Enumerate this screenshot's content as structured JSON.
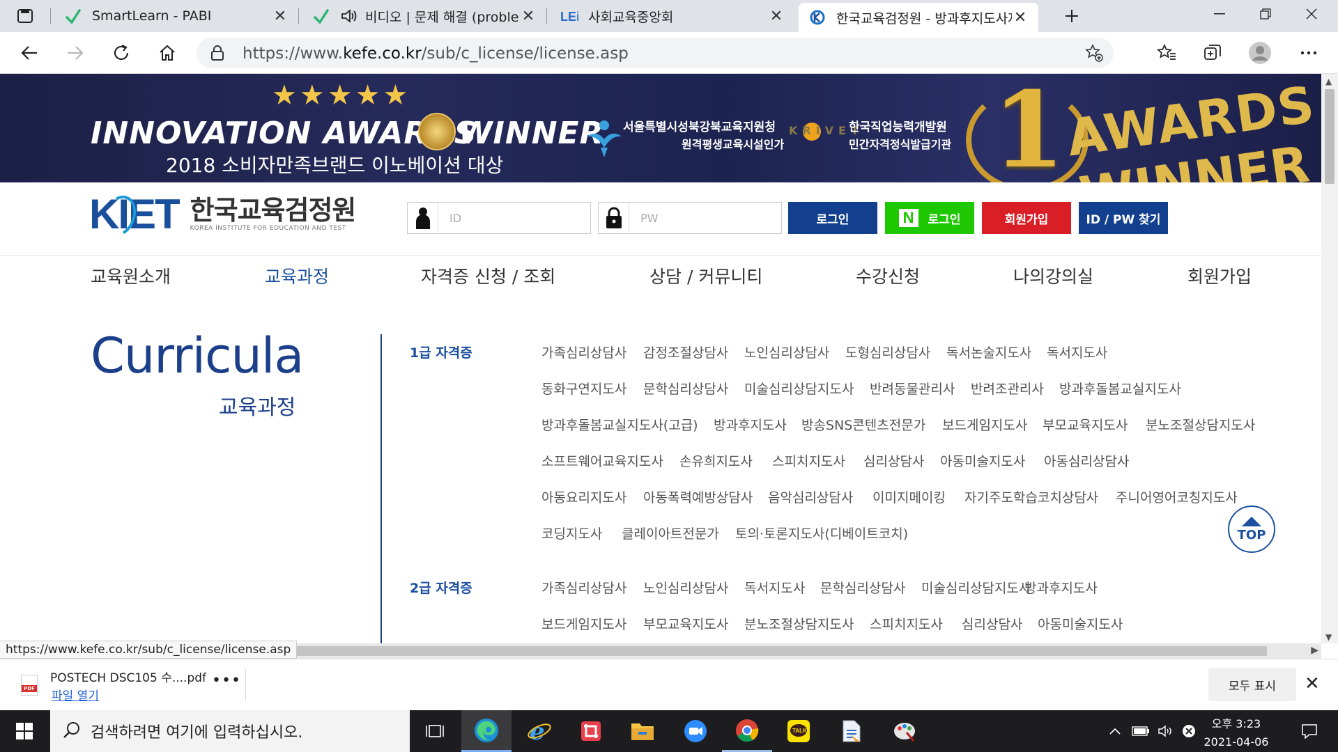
{
  "browser": {
    "tabs": [
      {
        "title": "SmartLearn - PABI",
        "active": false
      },
      {
        "title": "비디오 | 문제 해결 (problem",
        "active": false,
        "audio": true
      },
      {
        "title": "사회교육중앙회",
        "active": false
      },
      {
        "title": "한국교육검정원 - 방과후지도사자",
        "active": true
      }
    ],
    "url_prefix": "https://www.",
    "url_host": "kefe.co.kr",
    "url_path": "/sub/c_license/license.asp",
    "status_url": "https://www.kefe.co.kr/sub/c_license/license.asp"
  },
  "banner": {
    "stars": "★★★★★",
    "innovation": "INNOVATION AWARDS",
    "winner": "WINNER",
    "brand_award": "2018 소비자만족브랜드 이노베이션 대상",
    "seoul_line1": "서울특별시성북강북교육지원청",
    "seoul_line2": "원격평생교육시설인가",
    "krivet_logo": "KRIVET",
    "krivet_line1": "한국직업능력개발원",
    "krivet_line2": "민간자격정식발급기관",
    "big_number": "1",
    "awards_line1": "AWARDS",
    "awards_line2": "WINNER"
  },
  "site": {
    "logo_mark": "KIET",
    "logo_name": "한국교육검정원",
    "logo_en": "KOREA INSTITUTE FOR EDUCATION AND TEST",
    "id_placeholder": "ID",
    "pw_placeholder": "PW",
    "login_label": "로그인",
    "naver_mark": "N",
    "naver_login_label": "로그인",
    "join_label": "회원가입",
    "find_label": "ID / PW 찾기",
    "colors": {
      "login": "#12408f",
      "naver": "#1ec800",
      "join": "#d91e26",
      "find": "#12408f",
      "accent": "#1c3f8a"
    }
  },
  "gnb": [
    {
      "label": "교육원소개",
      "active": false
    },
    {
      "label": "교육과정",
      "active": true
    },
    {
      "label": "자격증 신청 / 조회",
      "active": false
    },
    {
      "label": "상담 / 커뮤니티",
      "active": false
    },
    {
      "label": "수강신청",
      "active": false
    },
    {
      "label": "나의강의실",
      "active": false
    },
    {
      "label": "회원가입",
      "active": false
    }
  ],
  "content": {
    "title": "Curricula",
    "subtitle": "교육과정",
    "grade1": {
      "label": "1급 자격증",
      "rows": [
        [
          "가족심리상담사",
          "감정조절상담사",
          "노인심리상담사",
          "도형심리상담사",
          "독서논술지도사",
          "독서지도사"
        ],
        [
          "동화구연지도사",
          "문학심리상담사",
          "미술심리상담지도사",
          "반려동물관리사",
          "반려조관리사",
          "방과후돌봄교실지도사"
        ],
        [
          "방과후돌봄교실지도사(고급)",
          "방과후지도사",
          "방송SNS콘텐츠전문가",
          "보드게임지도사",
          "부모교육지도사",
          "분노조절상담지도사"
        ],
        [
          "소프트웨어교육지도사",
          "손유희지도사",
          "스피치지도사",
          "심리상담사",
          "아동미술지도사",
          "아동심리상담사"
        ],
        [
          "아동요리지도사",
          "아동폭력예방상담사",
          "음악심리상담사",
          "이미지메이킹",
          "자기주도학습코치상담사",
          "주니어영어코칭지도사"
        ],
        [
          "코딩지도사",
          "클레이아트전문가",
          "토의·토론지도사(디베이트코치)"
        ]
      ]
    },
    "grade2": {
      "label": "2급 자격증",
      "rows": [
        [
          "가족심리상담사",
          "노인심리상담사",
          "독서지도사",
          "문학심리상담사",
          "미술심리상담지도사",
          "방과후지도사"
        ],
        [
          "보드게임지도사",
          "부모교육지도사",
          "분노조절상담지도사",
          "스피치지도사",
          "심리상담사",
          "아동미술지도사"
        ]
      ]
    },
    "top_button": "TOP"
  },
  "download": {
    "filename": "POSTECH DSC105 수....pdf",
    "open_link": "파일 열기",
    "file_badge": "PDF",
    "show_all": "모두 표시"
  },
  "taskbar": {
    "search_placeholder": "검색하려면 여기에 입력하십시오.",
    "time": "오후 3:23",
    "date": "2021-04-06",
    "kakao_label": "TALK"
  }
}
